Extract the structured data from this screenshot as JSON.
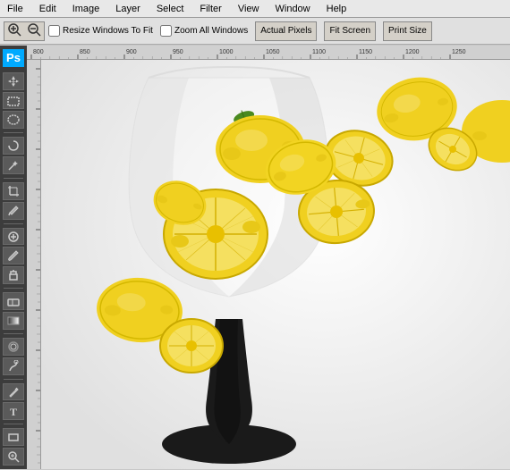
{
  "menubar": {
    "items": [
      "File",
      "Edit",
      "Image",
      "Layer",
      "Select",
      "Filter",
      "View",
      "Window",
      "Help"
    ]
  },
  "toolbar": {
    "zoom_in_label": "+",
    "zoom_out_label": "-",
    "checkboxes": [
      {
        "label": "Resize Windows To Fit",
        "checked": false
      },
      {
        "label": "Zoom All Windows",
        "checked": false
      }
    ],
    "buttons": [
      {
        "label": "Actual Pixels"
      },
      {
        "label": "Fit Screen"
      },
      {
        "label": "Print Size"
      }
    ]
  },
  "ruler": {
    "marks_h": [
      "800",
      "850",
      "900",
      "950",
      "1000",
      "1050",
      "1100",
      "1150",
      "1200",
      "1250"
    ],
    "marks_v": []
  },
  "tools": [
    {
      "name": "move",
      "symbol": "✛"
    },
    {
      "name": "marquee-rect",
      "symbol": "⬜"
    },
    {
      "name": "marquee-ellipse",
      "symbol": "⭕"
    },
    {
      "name": "lasso",
      "symbol": "⌀"
    },
    {
      "name": "magic-wand",
      "symbol": "✦"
    },
    {
      "name": "crop",
      "symbol": "⌗"
    },
    {
      "name": "eyedropper",
      "symbol": "💧"
    },
    {
      "name": "healing",
      "symbol": "✚"
    },
    {
      "name": "brush",
      "symbol": "✏"
    },
    {
      "name": "clone",
      "symbol": "♻"
    },
    {
      "name": "eraser",
      "symbol": "◻"
    },
    {
      "name": "gradient",
      "symbol": "▣"
    },
    {
      "name": "blur",
      "symbol": "◉"
    },
    {
      "name": "dodge",
      "symbol": "○"
    },
    {
      "name": "pen",
      "symbol": "✒"
    },
    {
      "name": "text",
      "symbol": "T"
    },
    {
      "name": "path",
      "symbol": "◫"
    },
    {
      "name": "shape",
      "symbol": "▭"
    },
    {
      "name": "zoom",
      "symbol": "🔍"
    }
  ],
  "colors": {
    "toolbar_bg": "#e0e0e0",
    "panel_bg": "#3c3c3c",
    "canvas_bg": "#b0b0b0",
    "ruler_bg": "#d0d0d0",
    "ps_logo_bg": "#1b9be0",
    "menu_bg": "#e8e8e8"
  }
}
